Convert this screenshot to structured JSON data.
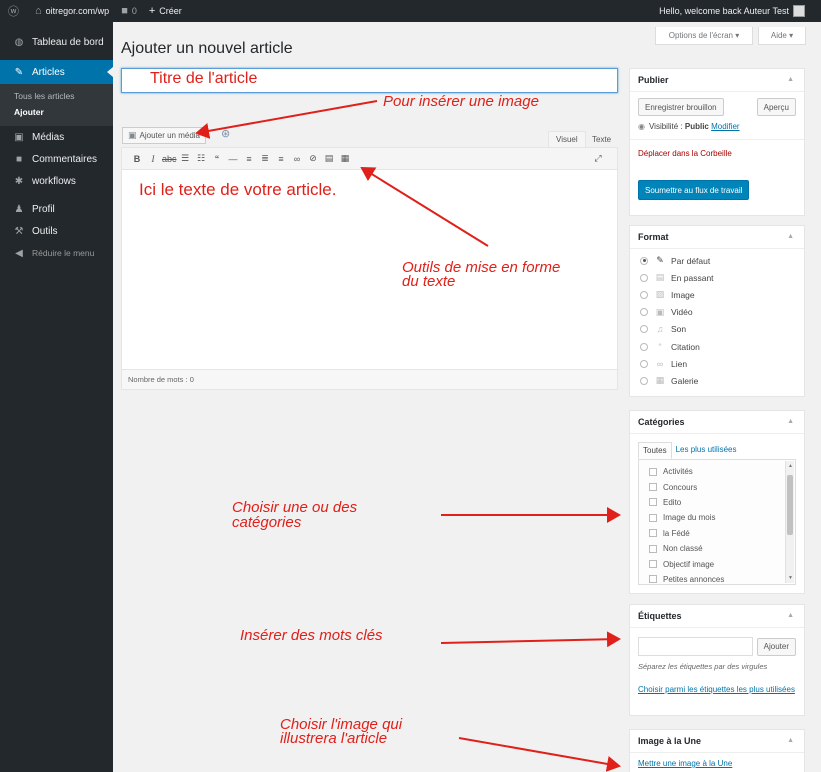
{
  "adminbar": {
    "site_name": "oitregor.com/wp",
    "comments_count": "0",
    "new_label": "Créer",
    "greeting": "Hello, welcome back Auteur Test"
  },
  "sidebar": {
    "items": [
      {
        "label": "Tableau de bord",
        "icon": "dashboard-icon"
      },
      {
        "label": "Articles",
        "icon": "pin-icon"
      },
      {
        "label": "Médias",
        "icon": "media-icon"
      },
      {
        "label": "Commentaires",
        "icon": "comment-icon"
      },
      {
        "label": "workflows",
        "icon": "gear-icon"
      },
      {
        "label": "Profil",
        "icon": "user-icon"
      },
      {
        "label": "Outils",
        "icon": "wrench-icon"
      },
      {
        "label": "Réduire le menu",
        "icon": "collapse-icon"
      }
    ],
    "submenu": [
      "Tous les articles",
      "Ajouter"
    ]
  },
  "screen_options_label": "Options de l'écran",
  "help_label": "Aide",
  "page_title": "Ajouter un nouvel article",
  "editor": {
    "add_media_label": "Ajouter un média",
    "tab_visual": "Visuel",
    "tab_text": "Texte",
    "word_count": "Nombre de mots : 0"
  },
  "publish": {
    "title": "Publier",
    "save_draft": "Enregistrer brouillon",
    "preview": "Aperçu",
    "visibility_label": "Visibilité :",
    "visibility_value": "Public",
    "modify": "Modifier",
    "trash": "Déplacer dans la Corbeille",
    "submit": "Soumettre au flux de travail"
  },
  "format": {
    "title": "Format",
    "options": [
      "Par défaut",
      "En passant",
      "Image",
      "Vidéo",
      "Son",
      "Citation",
      "Lien",
      "Galerie"
    ]
  },
  "categories": {
    "title": "Catégories",
    "tab_all": "Toutes",
    "tab_popular": "Les plus utilisées",
    "items": [
      "Activités",
      "Concours",
      "Edito",
      "Image du mois",
      "la Fédé",
      "Non classé",
      "Objectif image",
      "Petites annonces"
    ]
  },
  "tags": {
    "title": "Étiquettes",
    "add_button": "Ajouter",
    "help": "Séparez les étiquettes par des virgules",
    "choose_link": "Choisir parmi les étiquettes les plus utilisées"
  },
  "featured_image": {
    "title": "Image à la Une",
    "set_link": "Mettre une image à la Une"
  },
  "annotations": {
    "title": "Titre de l'article",
    "insert_image": "Pour insérer une image",
    "body_text": "Ici le texte de votre article.",
    "formatting_line1": "Outils de mise en forme",
    "formatting_line2": "du texte",
    "categories_line1": "Choisir une ou des",
    "categories_line2": "catégories",
    "keywords": "Insérer des mots clés",
    "image_line1": "Choisir l'image qui",
    "image_line2": "illustrera l'article"
  },
  "colors": {
    "admin_dark": "#23282d",
    "accent_blue": "#0073aa",
    "annotation_red": "#e0201a",
    "trash_red": "#aa0000"
  }
}
